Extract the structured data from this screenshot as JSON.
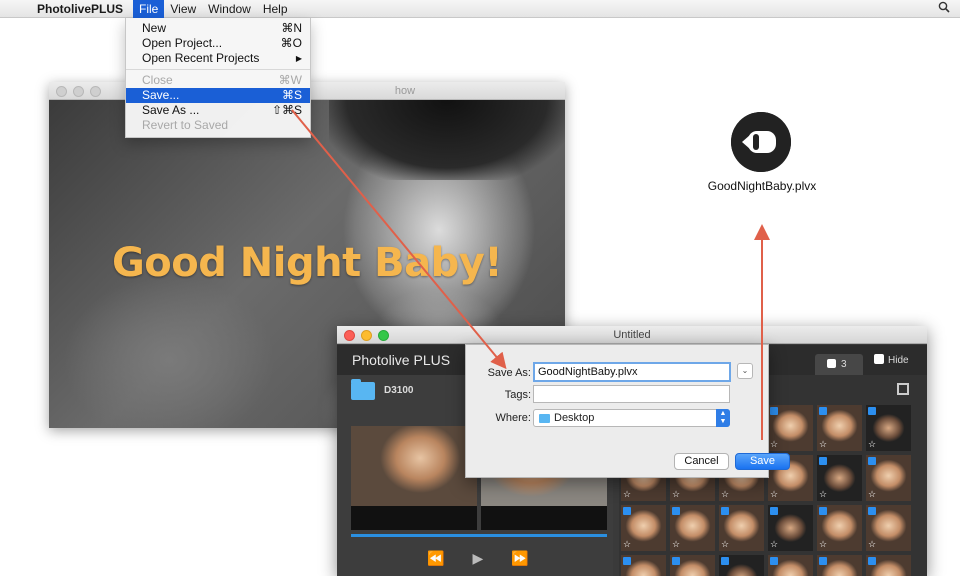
{
  "menubar": {
    "apple_icon": "apple-icon",
    "app_name": "PhotolivePLUS",
    "menus": [
      "File",
      "View",
      "Window",
      "Help"
    ],
    "search_icon": "magnifier-icon"
  },
  "file_menu": {
    "new": {
      "label": "New",
      "shortcut": "⌘N"
    },
    "open_project": {
      "label": "Open Project...",
      "shortcut": "⌘O"
    },
    "open_recent": {
      "label": "Open Recent Projects",
      "shortcut": "▶"
    },
    "close": {
      "label": "Close",
      "shortcut": "⌘W"
    },
    "save": {
      "label": "Save...",
      "shortcut": "⌘S"
    },
    "save_as": {
      "label": "Save As ...",
      "shortcut": "⇧⌘S"
    },
    "revert": {
      "label": "Revert to Saved"
    }
  },
  "slideshow_window": {
    "title_fragment": "how",
    "overlay_text": "Good Night Baby!",
    "overlay_color": "#f5b64e"
  },
  "desktop_file": {
    "filename": "GoodNightBaby.plvx",
    "icon": "plvx-document-icon"
  },
  "main_window": {
    "title": "Untitled",
    "brand": "Photolive PLUS",
    "tab_count": "3",
    "hide_label": "Hide",
    "folder_name": "D3100",
    "controls": [
      "⏪",
      "▶",
      "⏩"
    ]
  },
  "save_sheet": {
    "save_as_label": "Save As:",
    "save_as_value": "GoodNightBaby.plvx",
    "tags_label": "Tags:",
    "tags_value": "",
    "where_label": "Where:",
    "where_value": "Desktop",
    "cancel_label": "Cancel",
    "save_label": "Save"
  },
  "colors": {
    "accent": "#1a5fd6",
    "arrow": "#e0604a",
    "checkbox": "#2c8ff0"
  }
}
